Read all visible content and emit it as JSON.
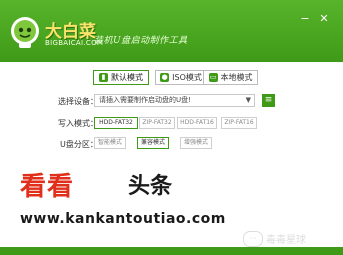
{
  "header": {
    "title": "大白菜",
    "subtitle": "BIGBAICAI.COM",
    "slogan": "装机U盘启动制作工具",
    "minimize_icon": "minimize-icon",
    "close_icon": "close-icon",
    "accent_color": "#3f9a18"
  },
  "tabs": [
    {
      "label": "默认模式",
      "icon": "usb-icon",
      "selected": true
    },
    {
      "label": "ISO模式",
      "icon": "disc-icon",
      "selected": false
    },
    {
      "label": "本地模式",
      "icon": "monitor-icon",
      "selected": false
    }
  ],
  "device": {
    "label": "选择设备：",
    "placeholder": "请插入需要制作启动盘的U盘!"
  },
  "write_mode": {
    "label": "写入模式：",
    "options": [
      "HDD-FAT32",
      "ZIP-FAT32",
      "HDD-FAT16",
      "ZIP-FAT16"
    ],
    "selected": "HDD-FAT32"
  },
  "partition": {
    "label": "U盘分区：",
    "options": [
      "智能模式",
      "兼容模式",
      "增强模式"
    ],
    "selected": "兼容模式"
  },
  "watermark": {
    "main_red": "看看",
    "main_black": "头条",
    "url": "www.kankantoutiao.com",
    "corner_text": "毒毒星球",
    "corner_icon": "chat-bubble-icon"
  }
}
